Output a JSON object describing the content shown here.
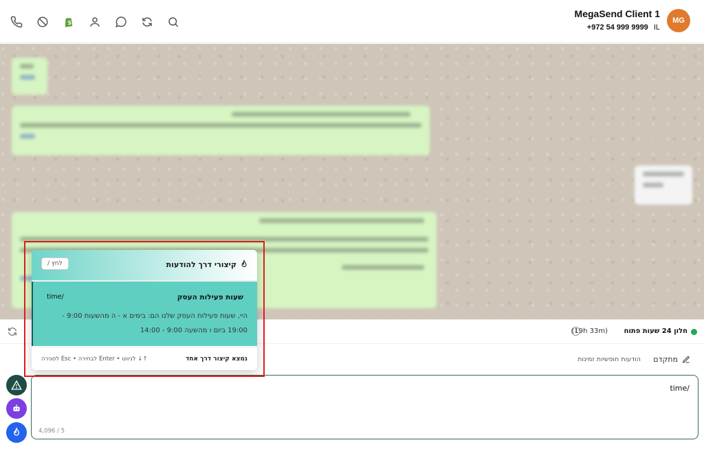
{
  "header": {
    "contact_name": "MegaSend Client 1",
    "phone": "+972 54 999 9999",
    "country": "IL",
    "avatar_initials": "MG",
    "icons": [
      "phone-icon",
      "block-icon",
      "shopify-icon",
      "user-icon",
      "whatsapp-icon",
      "refresh-icon",
      "search-icon"
    ]
  },
  "window_bar": {
    "label": "חלון 24 שעות פתוח",
    "time_left": "(19h 33m)",
    "status_color": "#1fa855"
  },
  "options": {
    "advanced_label": "מתקדם",
    "temp_messages_label": "הודעות חופשיות זמינות"
  },
  "composer": {
    "text": "time/",
    "char_count": "4,096 / 5"
  },
  "popup": {
    "title": "קיצורי דרך להודעות",
    "esc_label": "לחץ /",
    "item": {
      "title": "שעות פעילות העסק",
      "code": "time/",
      "body": "היי, שעות פעילות העסק שלנו הם: בימים א - ה מהשעות 9:00 - 19:00 ביום ו מהשעה 9:00 - 14:00"
    },
    "footer_found": "נמצא קיצור דרך אחד",
    "footer_hint": "↑↓ לניווט • Enter לבחירה • Esc לסגירה"
  },
  "colors": {
    "accent": "#2f6b5f",
    "popup_item": "#5fcfc2",
    "avatar": "#e07a2c",
    "highlight": "#e01b1b"
  }
}
